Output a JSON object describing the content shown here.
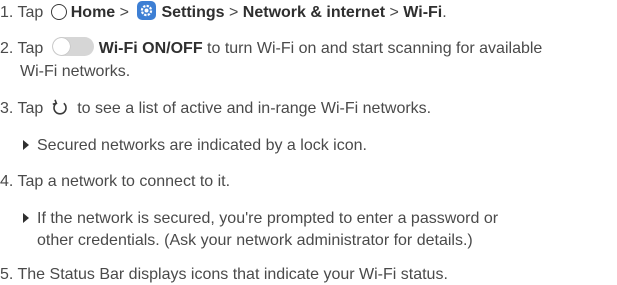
{
  "steps": {
    "s1": {
      "prefix": "1. Tap ",
      "home": "Home",
      "sep1": " > ",
      "settings": "Settings",
      "sep2": " > ",
      "network": "Network & internet",
      "sep3": " > ",
      "wifi": "Wi-Fi",
      "end": "."
    },
    "s2": {
      "prefix": "2. Tap ",
      "toggle_label": "Wi-Fi ON/OFF",
      "rest": " to turn Wi-Fi on and start scanning for available",
      "cont": "Wi-Fi networks."
    },
    "s3": {
      "prefix": "3. Tap ",
      "rest": " to see a list of active and in-range Wi-Fi networks."
    },
    "bullet1": "Secured networks are indicated by a lock icon.",
    "s4": "4. Tap a network to connect to it.",
    "bullet2": {
      "line1": "If the network is secured, you're prompted to enter a password or",
      "line2": "other credentials. (Ask your network administrator for details.)"
    },
    "s5": "5. The Status Bar displays icons that indicate your Wi-Fi status."
  },
  "colors": {
    "text": "#4a4a4a",
    "bold": "#2f2f2f",
    "settings_icon": "#3d7fd4",
    "toggle_off": "#d6d6d6"
  },
  "icons": {
    "home": "circle-home-icon",
    "settings": "gear-icon",
    "toggle": "toggle-switch-icon",
    "refresh": "refresh-icon",
    "bullet": "triangle-bullet-icon"
  }
}
